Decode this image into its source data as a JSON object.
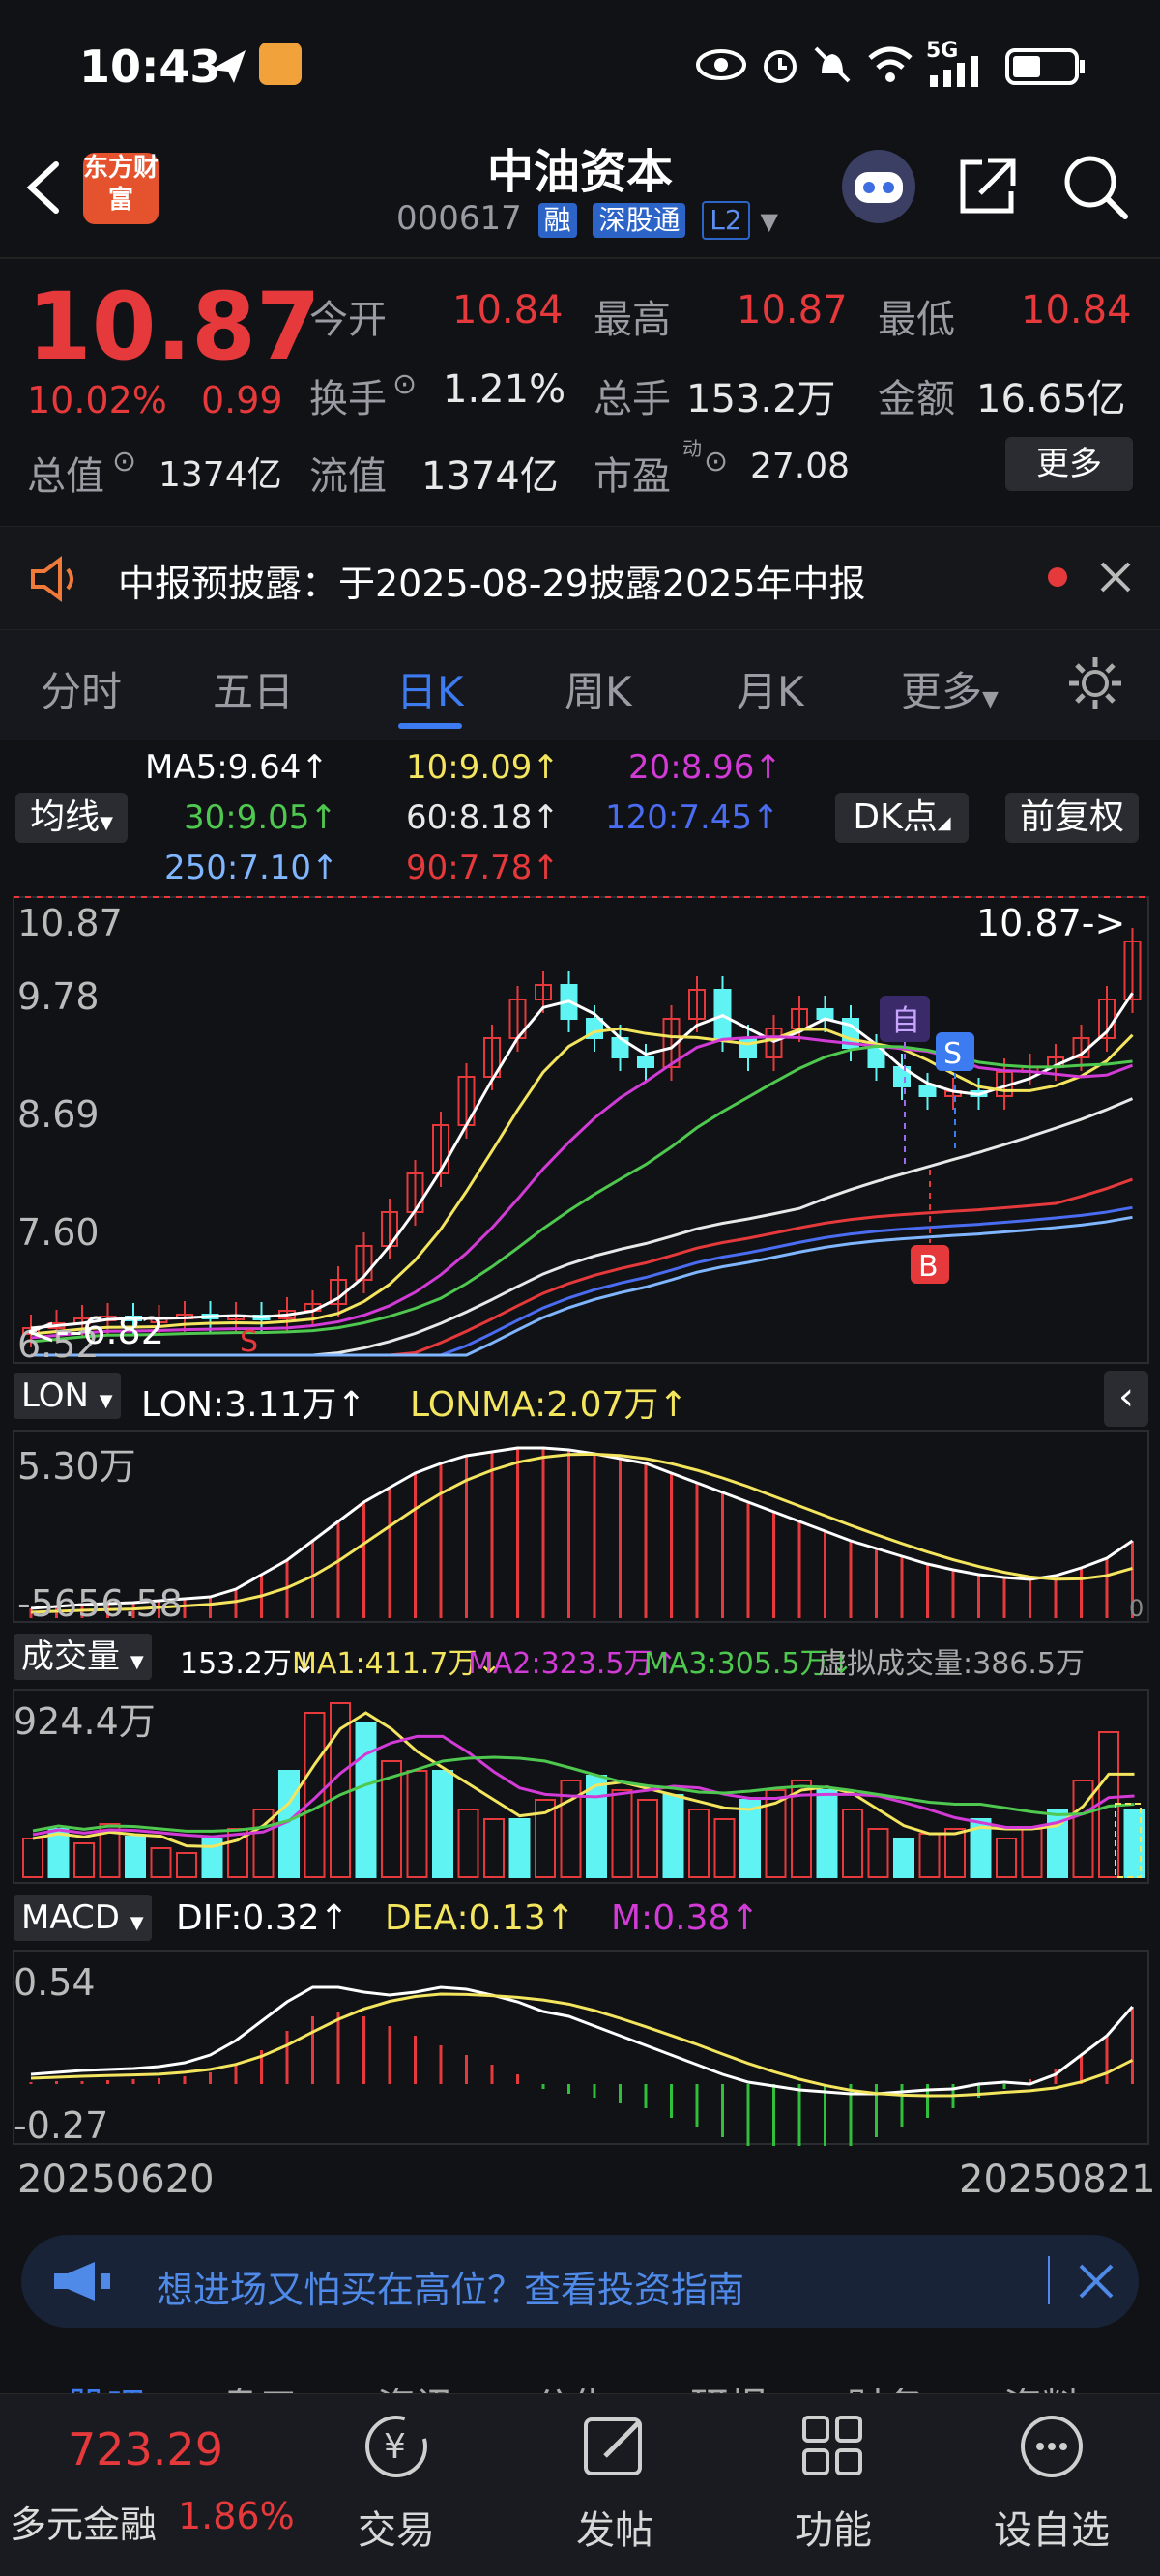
{
  "status_bar": {
    "time": "10:43",
    "network": "5G"
  },
  "header": {
    "logo_text": "东方财富",
    "title": "中油资本",
    "code": "000617",
    "tags": [
      "融",
      "深股通",
      "L2"
    ]
  },
  "quote": {
    "price": "10.87",
    "change_pct": "10.02%",
    "change": "0.99",
    "open_label": "今开",
    "open": "10.84",
    "high_label": "最高",
    "high": "10.87",
    "low_label": "最低",
    "low": "10.84",
    "turnover_label": "换手",
    "turnover": "1.21%",
    "volume_label": "总手",
    "volume": "153.2万",
    "amount_label": "金额",
    "amount": "16.65亿",
    "mktcap_label": "总值",
    "mktcap": "1374亿",
    "float_label": "流值",
    "float": "1374亿",
    "pe_label": "市盈",
    "pe_sup": "动",
    "pe": "27.08",
    "more": "更多"
  },
  "notice": {
    "text": "中报预披露：于2025-08-29披露2025年中报"
  },
  "tabs": [
    "分时",
    "五日",
    "日K",
    "周K",
    "月K",
    "更多"
  ],
  "active_tab": "日K",
  "ma_legend": {
    "avg_btn": "均线",
    "ma5": "MA5:9.64↑",
    "ma10": "10:9.09↑",
    "ma20": "20:8.96↑",
    "ma30": "30:9.05↑",
    "ma60": "60:8.18↑",
    "ma120": "120:7.45↑",
    "ma250": "250:7.10↑",
    "ma90": "90:7.78↑",
    "dk_btn": "DK点",
    "adj_btn": "前复权"
  },
  "price_chart": {
    "y_labels": [
      "10.87",
      "9.78",
      "8.69",
      "7.60",
      "6.52"
    ],
    "last_label": "10.87->",
    "min_label": "<--6.82",
    "marker_self": "自",
    "marker_s": "S",
    "marker_b": "B",
    "marker_s2": "S"
  },
  "lon": {
    "btn": "LON",
    "lon": "LON:3.11万↑",
    "lonma": "LONMA:2.07万↑",
    "top_label": "5.30万",
    "bottom_label": "-5656.58",
    "right_zero": "0"
  },
  "volume": {
    "btn": "成交量",
    "vol": "153.2万↓",
    "ma1": "MA1:411.7万↓",
    "ma2": "MA2:323.5万↑",
    "ma3": "MA3:305.5万↓",
    "virtual": "虚拟成交量:386.5万",
    "top_label": "924.4万"
  },
  "macd": {
    "btn": "MACD",
    "dif": "DIF:0.32↑",
    "dea": "DEA:0.13↑",
    "m": "M:0.38↑",
    "top_label": "0.54",
    "bottom_label": "-0.27"
  },
  "dates": {
    "start": "20250620",
    "end": "20250821"
  },
  "promo": {
    "text": "想进场又怕买在高位？查看投资指南"
  },
  "bottom_tabs": [
    "股吧",
    "盘口",
    "资讯",
    "公告",
    "研报",
    "财务",
    "资料"
  ],
  "bottom_nav": {
    "index_value": "723.29",
    "index_name": "多元金融",
    "index_pct": "1.86%",
    "items": [
      "交易",
      "发帖",
      "功能",
      "设自选"
    ]
  },
  "colors": {
    "up": "#e5393b",
    "down": "#5ff3f3",
    "accent": "#3d7cf0"
  }
}
